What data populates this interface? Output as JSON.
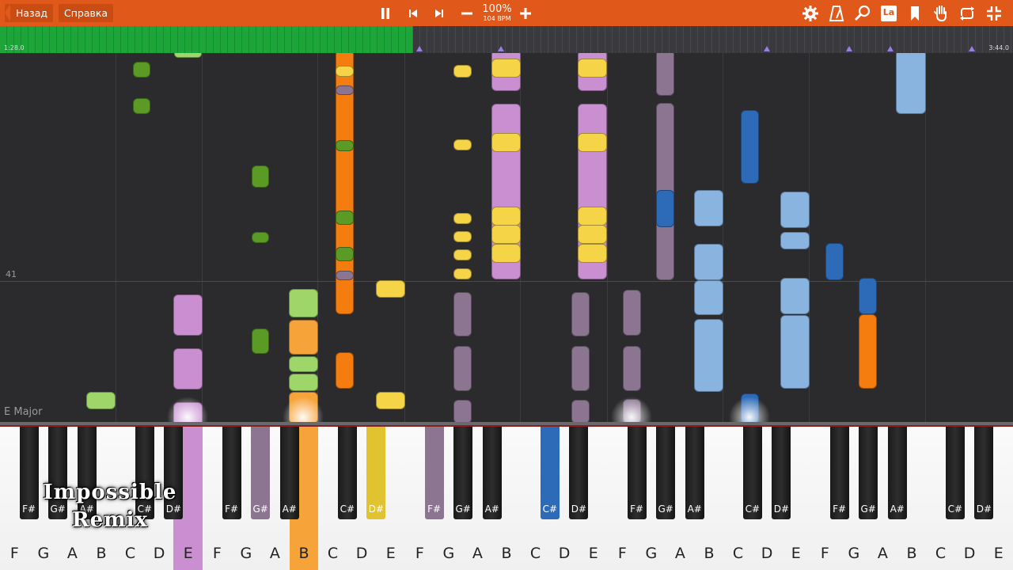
{
  "toolbar": {
    "back_label": "Назад",
    "help_label": "Справка",
    "tempo_percent": "100%",
    "tempo_bpm": "104 BPM",
    "icons": [
      "pause-icon",
      "skip-back-icon",
      "skip-forward-icon",
      "minus-icon",
      "plus-icon",
      "gear-icon",
      "metronome-icon",
      "search-icon",
      "label-toggle-icon",
      "bookmark-icon",
      "hand-icon",
      "loop-icon",
      "fullscreen-exit-icon"
    ],
    "label_toggle_text": "La"
  },
  "timeline": {
    "current_time": "1:28.0",
    "total_time": "3:44.0",
    "progress_fraction": 0.4
  },
  "roll": {
    "measure_number": "41",
    "key_signature": "E Major"
  },
  "overlay": {
    "line1": "Impossible",
    "line2": "Remix"
  },
  "keyboard": {
    "white_keys": [
      "F",
      "G",
      "A",
      "B",
      "C",
      "D",
      "E",
      "F",
      "G",
      "A",
      "B",
      "C",
      "D",
      "E",
      "F",
      "G",
      "A",
      "B",
      "C",
      "D",
      "E",
      "F",
      "G",
      "A",
      "B",
      "C",
      "D",
      "E",
      "F",
      "G",
      "A",
      "B",
      "C",
      "D",
      "E"
    ],
    "black_keys": [
      "F#",
      "G#",
      "A#",
      "C#",
      "D#",
      "F#",
      "G#",
      "A#",
      "C#",
      "D#",
      "F#",
      "G#",
      "A#",
      "C#",
      "D#",
      "F#",
      "G#",
      "A#",
      "C#",
      "D#",
      "F#",
      "G#",
      "A#",
      "C#",
      "D#"
    ],
    "pressed": [
      {
        "type": "white",
        "index": 6,
        "color": "#c98fd0"
      },
      {
        "type": "white",
        "index": 10,
        "color": "#f6a33a"
      },
      {
        "type": "black",
        "index": 6,
        "color": "#8b7591"
      },
      {
        "type": "black",
        "index": 9,
        "color": "#e0c32e"
      },
      {
        "type": "black",
        "index": 10,
        "color": "#8b7591"
      },
      {
        "type": "black",
        "index": 13,
        "color": "#2d6bb8"
      }
    ]
  },
  "colors": {
    "toolbar": "#e0581a",
    "progress": "#1ea53a",
    "green_dark": "#5a9a25",
    "green_light": "#9ed66a",
    "orange": "#f57c0f",
    "light_orange": "#f6a33a",
    "yellow": "#f5d547",
    "violet": "#c98fd0",
    "mauve": "#8b7591",
    "light_blue": "#8ab4e0",
    "blue": "#2d6bb8",
    "gold": "#e0c32e"
  }
}
